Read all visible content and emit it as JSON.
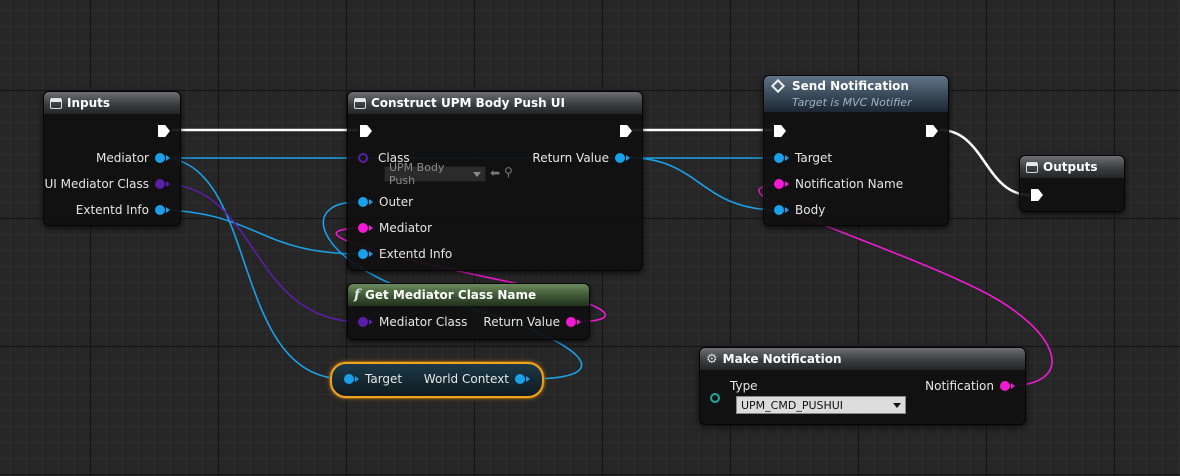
{
  "nodes": {
    "inputs": {
      "title": "Inputs",
      "pins": [
        "Mediator",
        "UI Mediator Class",
        "Extentd Info"
      ]
    },
    "construct": {
      "title": "Construct UPM Body Push UI",
      "class_label": "Class",
      "class_value": "UPM Body Push",
      "return_label": "Return Value",
      "outer_label": "Outer",
      "mediator_label": "Mediator",
      "extend_label": "Extentd Info"
    },
    "get_mediator": {
      "title": "Get Mediator Class Name",
      "in_label": "Mediator Class",
      "out_label": "Return Value"
    },
    "world_context": {
      "in_label": "Target",
      "out_label": "World Context"
    },
    "send_notification": {
      "title": "Send Notification",
      "subtitle": "Target is MVC Notifier",
      "pins": [
        "Target",
        "Notification Name",
        "Body"
      ]
    },
    "outputs": {
      "title": "Outputs"
    },
    "make_notification": {
      "title": "Make Notification",
      "type_label": "Type",
      "type_value": "UPM_CMD_PUSHUI",
      "out_label": "Notification"
    }
  },
  "colors": {
    "exec": "#ffffff",
    "object": "#1aa0e8",
    "class": "#5b1ea8",
    "name": "#f01ad4",
    "highlight": "#f0a020"
  }
}
